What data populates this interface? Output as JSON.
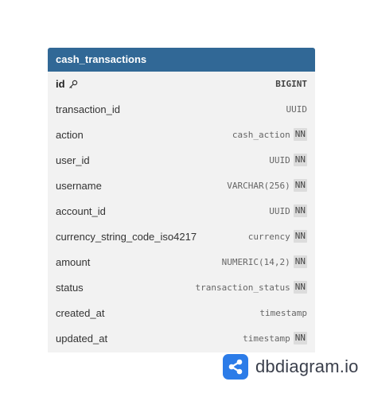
{
  "table": {
    "name": "cash_transactions",
    "header_color": "#316896",
    "columns": [
      {
        "name": "id",
        "type": "BIGINT",
        "nn": "",
        "pk": true
      },
      {
        "name": "transaction_id",
        "type": "UUID",
        "nn": ""
      },
      {
        "name": "action",
        "type": "cash_action",
        "nn": "NN"
      },
      {
        "name": "user_id",
        "type": "UUID",
        "nn": "NN"
      },
      {
        "name": "username",
        "type": "VARCHAR(256)",
        "nn": "NN"
      },
      {
        "name": "account_id",
        "type": "UUID",
        "nn": "NN"
      },
      {
        "name": "currency_string_code_iso4217",
        "type": "currency",
        "nn": "NN"
      },
      {
        "name": "amount",
        "type": "NUMERIC(14,2)",
        "nn": "NN"
      },
      {
        "name": "status",
        "type": "transaction_status",
        "nn": "NN"
      },
      {
        "name": "created_at",
        "type": "timestamp",
        "nn": ""
      },
      {
        "name": "updated_at",
        "type": "timestamp",
        "nn": "NN"
      }
    ]
  },
  "brand": {
    "text": "dbdiagram.io",
    "logo_icon": "share-nodes-icon",
    "color": "#2c7ce8"
  }
}
